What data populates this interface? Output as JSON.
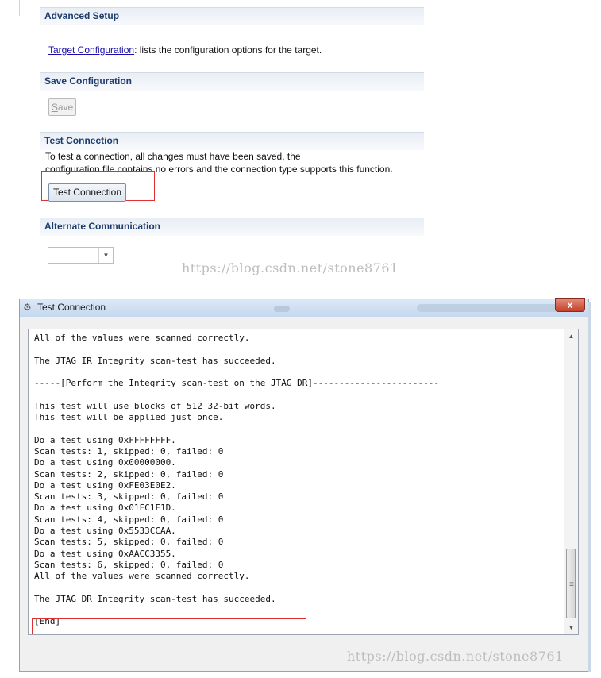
{
  "settings": {
    "advanced_setup": {
      "heading": "Advanced Setup",
      "link_text": "Target Configuration",
      "description": ": lists the configuration options for the target."
    },
    "save_configuration": {
      "heading": "Save Configuration",
      "save_label_prefix": "",
      "save_label_mnemonic": "S",
      "save_label_suffix": "ave"
    },
    "test_connection": {
      "heading": "Test Connection",
      "description_line1": "To test a connection, all changes must have been saved, the",
      "description_line2": "configuration file contains no errors and the connection type supports this function.",
      "button_label": "Test Connection"
    },
    "alternate_communication": {
      "heading": "Alternate Communication",
      "selected_value": ""
    }
  },
  "watermark_top": "https://blog.csdn.net/stone8761",
  "dialog": {
    "title": "Test Connection",
    "close_label": "x",
    "console_lines": [
      "All of the values were scanned correctly.",
      "",
      "The JTAG IR Integrity scan-test has succeeded.",
      "",
      "-----[Perform the Integrity scan-test on the JTAG DR]------------------------",
      "",
      "This test will use blocks of 512 32-bit words.",
      "This test will be applied just once.",
      "",
      "Do a test using 0xFFFFFFFF.",
      "Scan tests: 1, skipped: 0, failed: 0",
      "Do a test using 0x00000000.",
      "Scan tests: 2, skipped: 0, failed: 0",
      "Do a test using 0xFE03E0E2.",
      "Scan tests: 3, skipped: 0, failed: 0",
      "Do a test using 0x01FC1F1D.",
      "Scan tests: 4, skipped: 0, failed: 0",
      "Do a test using 0x5533CCAA.",
      "Scan tests: 5, skipped: 0, failed: 0",
      "Do a test using 0xAACC3355.",
      "Scan tests: 6, skipped: 0, failed: 0",
      "All of the values were scanned correctly.",
      "",
      "The JTAG DR Integrity scan-test has succeeded.",
      "",
      "[End]"
    ]
  },
  "watermark_bottom": "https://blog.csdn.net/stone8761",
  "icons": {
    "app": "gear-icon",
    "scroll_up": "chevron-up-icon",
    "scroll_down": "chevron-down-icon",
    "combo_arrow": "chevron-down-icon"
  },
  "colors": {
    "highlight_box": "#e03030",
    "section_heading": "#1d3c6c",
    "link": "#1a0dab"
  }
}
